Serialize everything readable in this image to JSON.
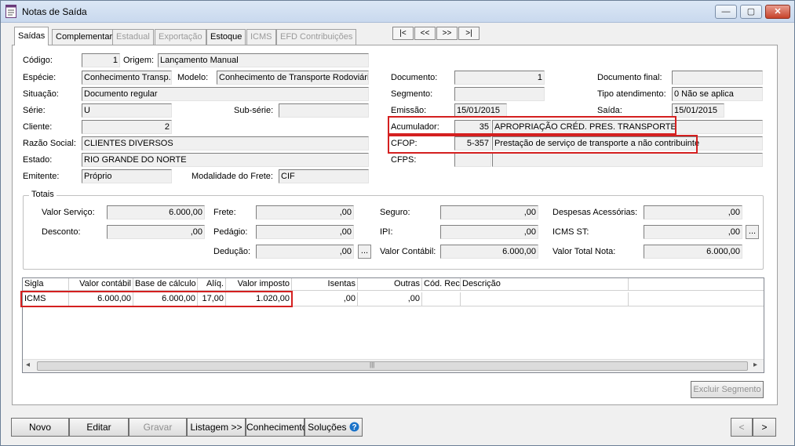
{
  "window": {
    "title": "Notas de Saída"
  },
  "tabs": [
    {
      "label": "Saídas"
    },
    {
      "label": "Complementar"
    },
    {
      "label": "Estadual"
    },
    {
      "label": "Exportação"
    },
    {
      "label": "Estoque"
    },
    {
      "label": "ICMS"
    },
    {
      "label": "EFD Contribuições"
    }
  ],
  "nav": {
    "first": "|<",
    "prev": "<<",
    "next": ">>",
    "last": ">|"
  },
  "form": {
    "codigo": {
      "label": "Código:",
      "value": "1"
    },
    "origem": {
      "label": "Origem:",
      "value": "Lançamento Manual"
    },
    "especie": {
      "label": "Espécie:",
      "value": "Conhecimento Transp. I"
    },
    "modelo": {
      "label": "Modelo:",
      "value": "Conhecimento de Transporte Rodoviário"
    },
    "situacao": {
      "label": "Situação:",
      "value": "Documento regular"
    },
    "serie": {
      "label": "Série:",
      "value": "U"
    },
    "subserie": {
      "label": "Sub-série:",
      "value": ""
    },
    "cliente": {
      "label": "Cliente:",
      "value": "2"
    },
    "razao_social": {
      "label": "Razão Social:",
      "value": "CLIENTES DIVERSOS"
    },
    "estado": {
      "label": "Estado:",
      "value": "RIO GRANDE DO NORTE"
    },
    "emitente": {
      "label": "Emitente:",
      "value": "Próprio"
    },
    "modalidade_frete": {
      "label": "Modalidade do Frete:",
      "value": "CIF"
    },
    "documento": {
      "label": "Documento:",
      "value": "1"
    },
    "documento_final": {
      "label": "Documento final:",
      "value": ""
    },
    "segmento": {
      "label": "Segmento:",
      "value": ""
    },
    "tipo_atendimento": {
      "label": "Tipo atendimento:",
      "value": "0 Não se aplica"
    },
    "emissao": {
      "label": "Emissão:",
      "value": "15/01/2015"
    },
    "saida": {
      "label": "Saída:",
      "value": "15/01/2015"
    },
    "acumulador": {
      "label": "Acumulador:",
      "code": "35",
      "desc": "APROPRIAÇÃO CRÉD. PRES. TRANSPORTE"
    },
    "cfop": {
      "label": "CFOP:",
      "code": "5-357",
      "desc": "Prestação de serviço de transporte a não contribuinte"
    },
    "cfps": {
      "label": "CFPS:",
      "code": "",
      "desc": ""
    }
  },
  "totais": {
    "title": "Totais",
    "valor_servico": {
      "label": "Valor Serviço:",
      "value": "6.000,00"
    },
    "frete": {
      "label": "Frete:",
      "value": ",00"
    },
    "seguro": {
      "label": "Seguro:",
      "value": ",00"
    },
    "despesas_acessorias": {
      "label": "Despesas Acessórias:",
      "value": ",00"
    },
    "desconto": {
      "label": "Desconto:",
      "value": ",00"
    },
    "pedagio": {
      "label": "Pedágio:",
      "value": ",00"
    },
    "ipi": {
      "label": "IPI:",
      "value": ",00"
    },
    "icms_st": {
      "label": "ICMS ST:",
      "value": ",00"
    },
    "deducao": {
      "label": "Dedução:",
      "value": ",00"
    },
    "valor_contabil": {
      "label": "Valor Contábil:",
      "value": "6.000,00"
    },
    "valor_total_nota": {
      "label": "Valor Total Nota:",
      "value": "6.000,00"
    },
    "ellipsis": "..."
  },
  "grid": {
    "headers": [
      "Sigla",
      "Valor contábil",
      "Base de cálculo",
      "Alíq.",
      "Valor imposto",
      "Isentas",
      "Outras",
      "Cód. Rec.",
      "Descrição"
    ],
    "rows": [
      [
        "ICMS",
        "6.000,00",
        "6.000,00",
        "17,00",
        "1.020,00",
        ",00",
        ",00",
        "",
        ""
      ]
    ],
    "scroll_left": "◂",
    "scroll_right": "▸",
    "scroll_grip": "|||"
  },
  "buttons": {
    "excluir_segmento": "Excluir Segmento",
    "novo": "Novo",
    "editar": "Editar",
    "gravar": "Gravar",
    "listagem": "Listagem >>",
    "conhecimento": "Conhecimento",
    "solucoes": "Soluções",
    "prev": "<",
    "next": ">"
  },
  "window_controls": {
    "minimize": "—",
    "maximize": "▢",
    "close": "✕"
  },
  "colors": {
    "highlight": "#d42020",
    "help": "#1a73c9"
  }
}
